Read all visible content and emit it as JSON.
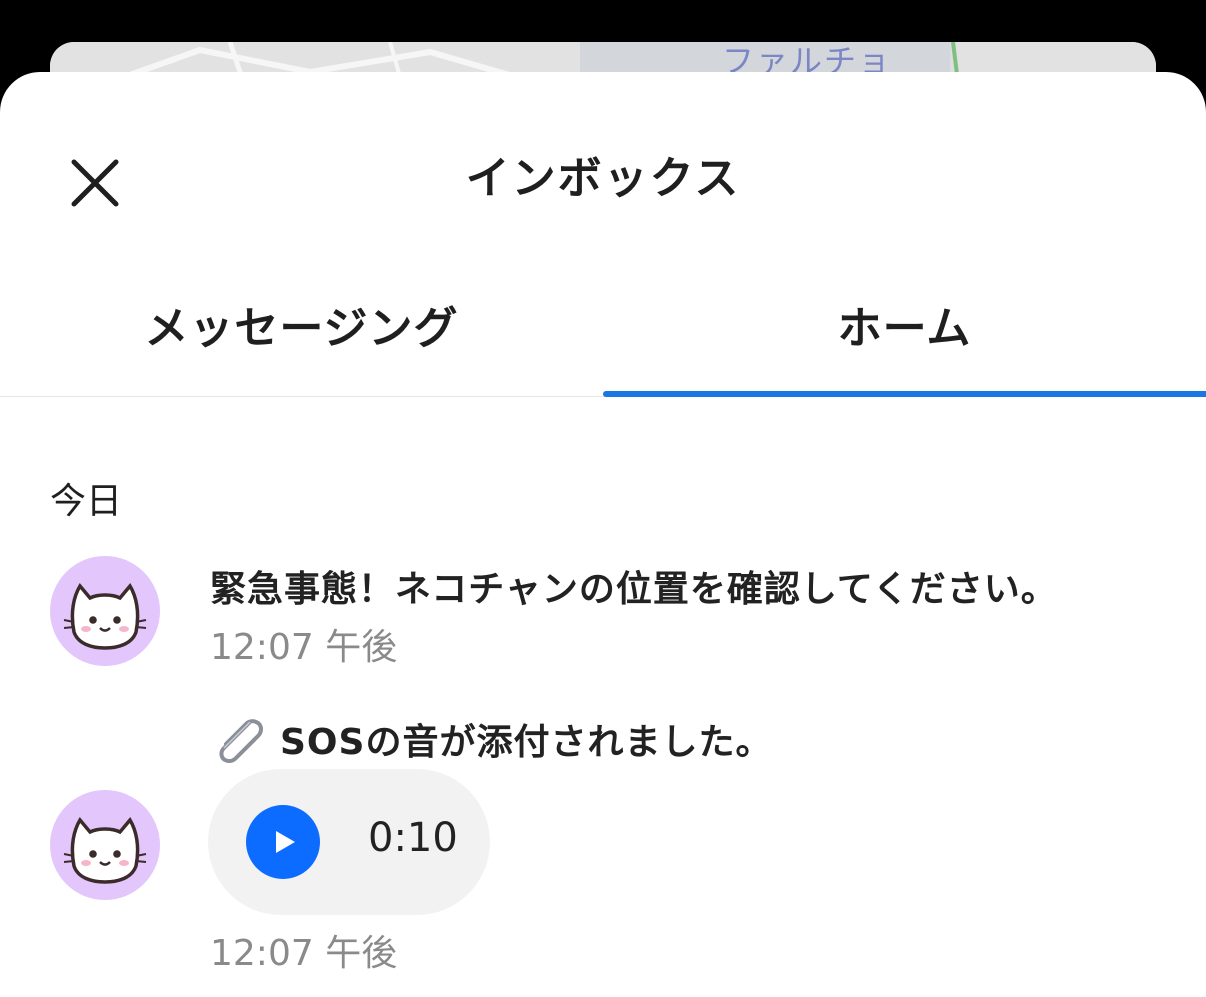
{
  "map": {
    "label": "ファルチョ"
  },
  "header": {
    "title": "インボックス"
  },
  "tabs": [
    {
      "label": "メッセージング",
      "active": false
    },
    {
      "label": "ホーム",
      "active": true
    }
  ],
  "section": {
    "label": "今日"
  },
  "messages": [
    {
      "text": "緊急事態！ネコチャンの位置を確認してください。",
      "time": "12:07 午後"
    },
    {
      "attachment_text": "SOSの音が添付されました。",
      "audio_duration": "0:10",
      "time": "12:07 午後"
    }
  ],
  "colors": {
    "accent": "#1976e3",
    "play_button": "#0b6cff",
    "avatar_bg": "#e3c6fb"
  },
  "icons": {
    "close": "close-icon",
    "avatar": "cat-icon",
    "attachment": "paperclip-icon",
    "play": "play-icon"
  }
}
